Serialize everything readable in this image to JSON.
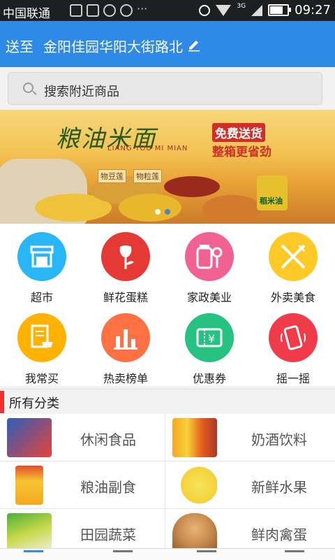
{
  "status_bar": {
    "carrier": "中国联通",
    "network": "3G",
    "time": "09:27"
  },
  "header": {
    "label": "送至",
    "address": "金阳佳园华阳大街路北",
    "accent": "#2e8ae6"
  },
  "search": {
    "placeholder": "搜索附近商品"
  },
  "banner": {
    "title": "粮油米面",
    "subtitle": "LIANG YOU MI MIAN",
    "badge_primary": "免费送货",
    "badge_secondary": "整箱更省劲",
    "tags": [
      "物豆莲",
      "物粒莲"
    ],
    "product_label": "稻米油",
    "slides_total": 2,
    "active_slide": 2
  },
  "grid": {
    "items": [
      {
        "label": "超市",
        "icon": "storefront-icon",
        "color": "#29b6f6"
      },
      {
        "label": "鲜花蛋糕",
        "icon": "flower-icon",
        "color": "#e53935"
      },
      {
        "label": "家政美业",
        "icon": "cosmetics-icon",
        "color": "#f06292"
      },
      {
        "label": "外卖美食",
        "icon": "cutlery-icon",
        "color": "#ffca28"
      },
      {
        "label": "我常买",
        "icon": "receipt-cart-icon",
        "color": "#ffb300"
      },
      {
        "label": "热卖榜单",
        "icon": "bar-chart-icon",
        "color": "#ff7043"
      },
      {
        "label": "优惠券",
        "icon": "coupon-icon",
        "color": "#26c281"
      },
      {
        "label": "摇一摇",
        "icon": "shake-phone-icon",
        "color": "#ef3b4a"
      }
    ]
  },
  "categories": {
    "title": "所有分类",
    "accent": "#e8332e",
    "items": [
      {
        "label": "休闲食品",
        "image": "snack-chips-image"
      },
      {
        "label": "奶酒饮料",
        "image": "drink-bottles-image"
      },
      {
        "label": "粮油副食",
        "image": "cooking-oil-image"
      },
      {
        "label": "新鲜水果",
        "image": "melon-image"
      },
      {
        "label": "田园蔬菜",
        "image": "vegetables-image"
      },
      {
        "label": "鲜肉禽蛋",
        "image": "egg-basket-image"
      }
    ]
  }
}
